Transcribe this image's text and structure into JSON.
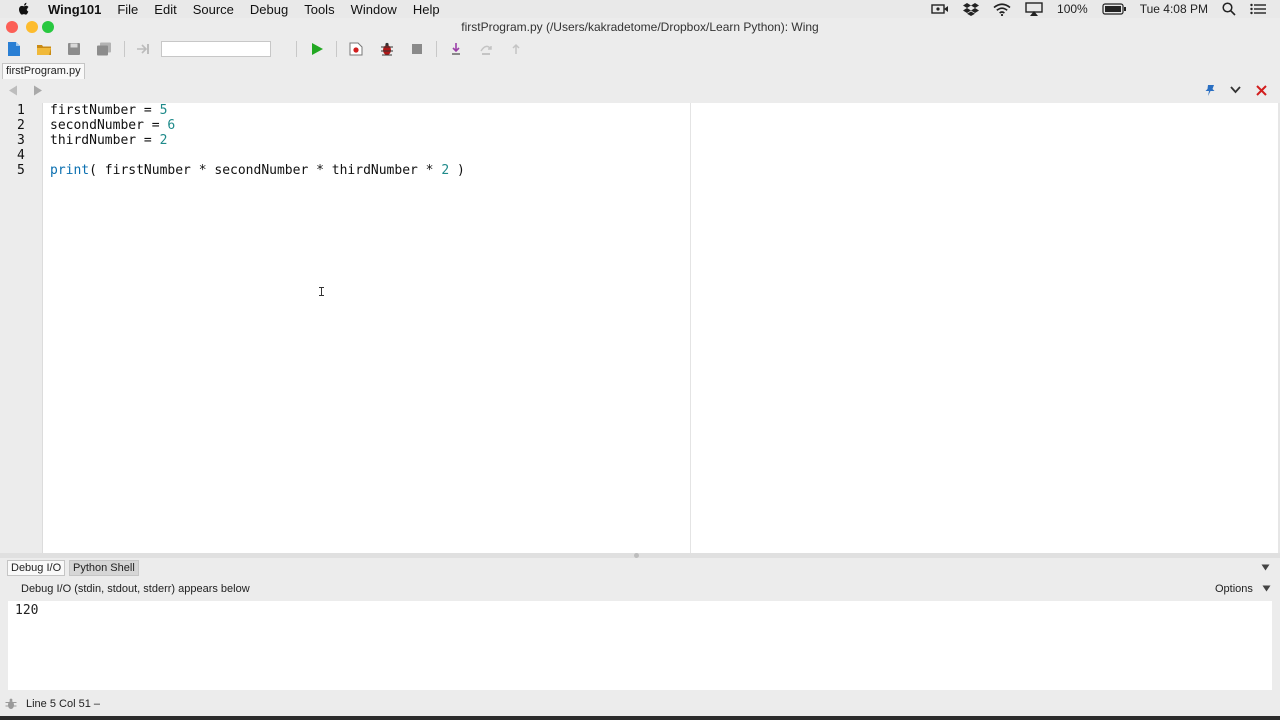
{
  "menubar": {
    "app_name": "Wing101",
    "items": [
      "File",
      "Edit",
      "Source",
      "Debug",
      "Tools",
      "Window",
      "Help"
    ],
    "battery": "100%",
    "clock": "Tue 4:08 PM"
  },
  "window": {
    "title": "firstProgram.py (/Users/kakradetome/Dropbox/Learn Python): Wing"
  },
  "editor": {
    "tab_label": "firstProgram.py",
    "lines": [
      {
        "no": "1",
        "name": "firstNumber",
        "op": " = ",
        "value": "5"
      },
      {
        "no": "2",
        "name": "secondNumber",
        "op": " = ",
        "value": "6"
      },
      {
        "no": "3",
        "name": "thirdNumber",
        "op": " = ",
        "value": "2"
      },
      {
        "no": "4"
      },
      {
        "no": "5",
        "fn": "print",
        "rest": "( firstNumber * secondNumber * thirdNumber * ",
        "value": "2",
        "close": " )"
      }
    ]
  },
  "bottom_panel": {
    "tabs": [
      "Debug I/O",
      "Python Shell"
    ],
    "header_text": "Debug I/O (stdin, stdout, stderr) appears below",
    "options_label": "Options",
    "output": "120"
  },
  "status": {
    "position": "Line 5 Col 51 –"
  },
  "colors": {
    "number": "#1e8a8a",
    "keyword": "#0a6fb0",
    "run_green": "#22a822",
    "close_red": "#d21e1e"
  }
}
